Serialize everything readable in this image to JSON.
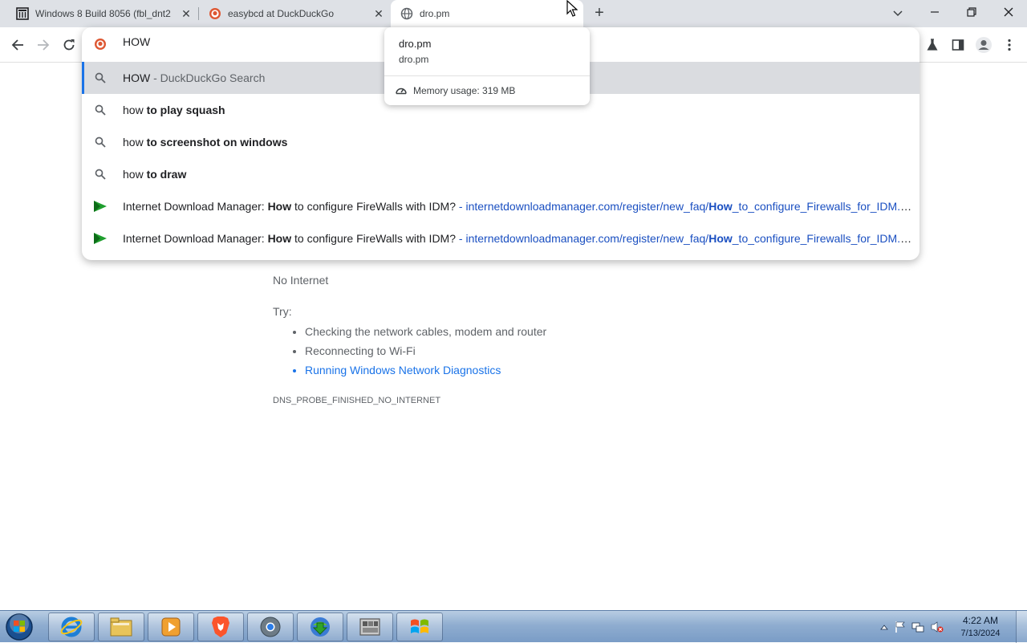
{
  "tabs": [
    {
      "title": "Windows 8 Build 8056 (fbl_dnt2",
      "icon": "archive-icon",
      "active": false
    },
    {
      "title": "easybcd at DuckDuckGo",
      "icon": "duckduckgo-icon",
      "active": false
    },
    {
      "title": "dro.pm",
      "icon": "globe-icon",
      "active": true
    }
  ],
  "omnibox": {
    "value": "HOW",
    "suggestions": [
      {
        "prefix": "HOW",
        "bold": "",
        "suffix": " - DuckDuckGo Search",
        "kind": "search",
        "selected": true
      },
      {
        "prefix": "how",
        "bold": " to play squash",
        "suffix": "",
        "kind": "search",
        "selected": false
      },
      {
        "prefix": "how",
        "bold": " to screenshot on windows",
        "suffix": "",
        "kind": "search",
        "selected": false
      },
      {
        "prefix": "how",
        "bold": " to draw",
        "suffix": "",
        "kind": "search",
        "selected": false
      },
      {
        "title_pre": "Internet Download Manager: ",
        "title_bold": "How",
        "title_post": " to configure FireWalls with IDM?",
        "sep": " - ",
        "url_pre": "internetdownloadmanager.com/register/new_faq/",
        "url_bold": "How",
        "url_post": "_to_configure_Firewalls_for_IDM.html",
        "kind": "page"
      },
      {
        "title_pre": "Internet Download Manager: ",
        "title_bold": "How",
        "title_post": " to configure FireWalls with IDM?",
        "sep": " - ",
        "url_pre": "internetdownloadmanager.com/register/new_faq/",
        "url_bold": "How",
        "url_post": "_to_configure_Firewalls_for_IDM.html",
        "kind": "page"
      }
    ]
  },
  "hovercard": {
    "title": "dro.pm",
    "domain": "dro.pm",
    "memory": "Memory usage: 319 MB"
  },
  "error_page": {
    "heading": "No Internet",
    "try_label": "Try:",
    "items": [
      "Checking the network cables, modem and router",
      "Reconnecting to Wi-Fi"
    ],
    "link": "Running Windows Network Diagnostics",
    "code": "DNS_PROBE_FINISHED_NO_INTERNET"
  },
  "taskbar": {
    "apps": [
      "internet-explorer-icon",
      "file-explorer-icon",
      "media-player-icon",
      "brave-icon",
      "chrome-canary-icon",
      "idm-icon",
      "windows-8-archive-icon",
      "windows-logo-icon"
    ],
    "clock_time": "4:22 AM",
    "clock_date": "7/13/2024"
  },
  "colors": {
    "accent": "#1a73e8",
    "link": "#1a4fc1",
    "selected_row": "#dadce0"
  }
}
